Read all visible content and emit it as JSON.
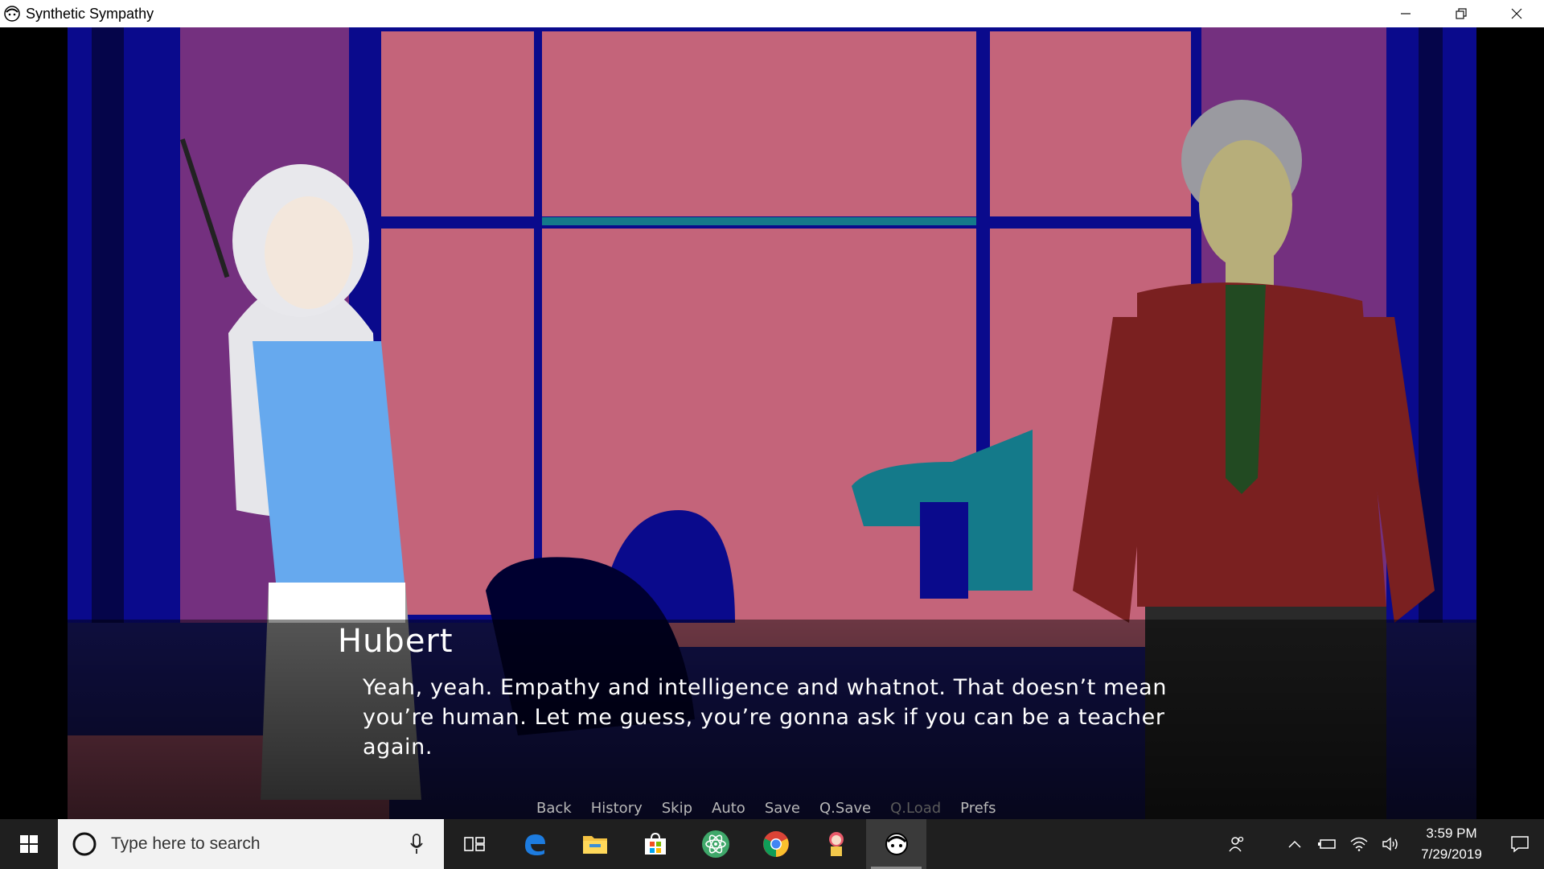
{
  "window": {
    "title": "Synthetic Sympathy",
    "minimize_icon": "minimize-icon",
    "restore_icon": "restore-icon",
    "close_icon": "close-icon"
  },
  "scene": {
    "background": "office-window-scene",
    "characters": [
      "girl-with-headset",
      "man-red-shirt"
    ],
    "colors": {
      "wall": "#74307f",
      "window_glass": "#c4647a",
      "frame": "#0a0a8c",
      "teal": "#147a8a"
    }
  },
  "dialogue": {
    "speaker": "Hubert",
    "text": "Yeah, yeah. Empathy and intelligence and whatnot. That doesn’t mean you’re human. Let me guess, you’re gonna ask if you can be a teacher again."
  },
  "quick_menu": [
    {
      "label": "Back",
      "enabled": true
    },
    {
      "label": "History",
      "enabled": true
    },
    {
      "label": "Skip",
      "enabled": true
    },
    {
      "label": "Auto",
      "enabled": true
    },
    {
      "label": "Save",
      "enabled": true
    },
    {
      "label": "Q.Save",
      "enabled": true
    },
    {
      "label": "Q.Load",
      "enabled": false
    },
    {
      "label": "Prefs",
      "enabled": true
    }
  ],
  "taskbar": {
    "search_placeholder": "Type here to search",
    "apps": [
      "task-view-icon",
      "edge-icon",
      "file-explorer-icon",
      "store-icon",
      "atom-icon",
      "chrome-icon",
      "game-character-icon",
      "synthetic-sympathy-icon"
    ],
    "time": "3:59 PM",
    "date": "7/29/2019"
  }
}
